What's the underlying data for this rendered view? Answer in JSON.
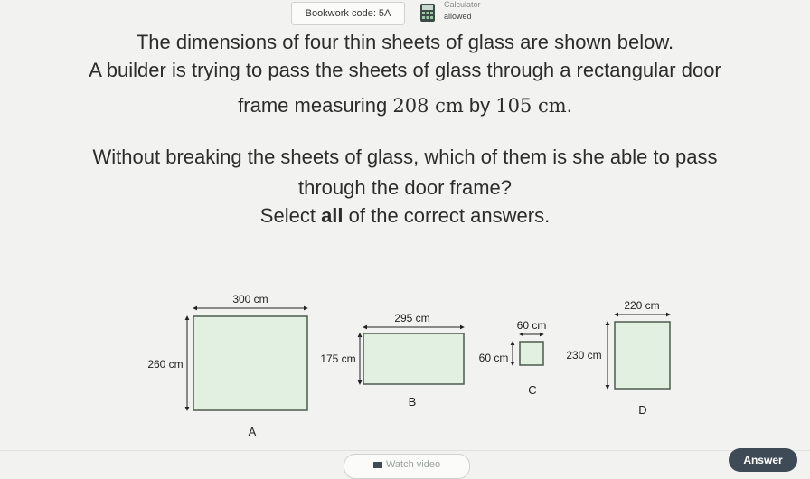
{
  "header": {
    "bookwork_code": "Bookwork code: 5A",
    "calculator_line1": "Calculator",
    "calculator_line2": "allowed"
  },
  "question": {
    "line1": "The dimensions of four thin sheets of glass are shown below.",
    "line2": "A builder is trying to pass the sheets of glass through a rectangular door",
    "line3_prefix": "frame measuring ",
    "line3_value1": "208 cm",
    "line3_mid": " by ",
    "line3_value2": "105 cm",
    "line3_suffix": ".",
    "line4": "Without breaking the sheets of glass, which of them is she able to pass",
    "line5": "through the door frame?",
    "line6_prefix": "Select ",
    "line6_bold": "all",
    "line6_suffix": " of the correct answers."
  },
  "sheets": [
    {
      "letter": "A",
      "width_label": "300 cm",
      "height_label": "260 cm"
    },
    {
      "letter": "B",
      "width_label": "295 cm",
      "height_label": "175 cm"
    },
    {
      "letter": "C",
      "width_label": "60 cm",
      "height_label": "60 cm"
    },
    {
      "letter": "D",
      "width_label": "220 cm",
      "height_label": "230 cm"
    }
  ],
  "footer": {
    "watch_video": "Watch video",
    "answer": "Answer"
  },
  "colors": {
    "glass_fill": "#e1f0e1",
    "glass_stroke": "#4d5a4d",
    "answer_bg": "#3f4a57"
  }
}
